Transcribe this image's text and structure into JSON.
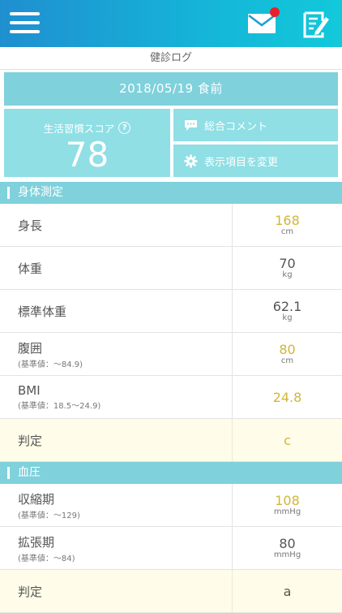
{
  "header": {
    "title": "健診ログ",
    "icons": [
      "menu-icon",
      "mail-icon",
      "edit-note-icon"
    ],
    "notification": true
  },
  "summary": {
    "date": "2018/05/19 食前",
    "score_label": "生活習慣スコア",
    "score_value": "78",
    "comment_label": "総合コメント",
    "change_items_label": "表示項目を変更"
  },
  "sections": {
    "body": {
      "title": "身体測定",
      "height": {
        "label": "身長",
        "value": "168",
        "unit": "cm"
      },
      "weight": {
        "label": "体重",
        "value": "70",
        "unit": "kg"
      },
      "std_weight": {
        "label": "標準体重",
        "value": "62.1",
        "unit": "kg"
      },
      "waist": {
        "label": "腹囲",
        "sub": "(基準値：〜84.9)",
        "value": "80",
        "unit": "cm"
      },
      "bmi": {
        "label": "BMI",
        "sub": "(基準値：18.5〜24.9)",
        "value": "24.8"
      },
      "judgement": {
        "label": "判定",
        "value": "c"
      }
    },
    "bp": {
      "title": "血圧",
      "systolic": {
        "label": "収縮期",
        "sub": "(基準値：〜129)",
        "value": "108",
        "unit": "mmHg"
      },
      "diastolic": {
        "label": "拡張期",
        "sub": "(基準値：〜84)",
        "value": "80",
        "unit": "mmHg"
      },
      "judgement": {
        "label": "判定",
        "value": "a"
      }
    }
  },
  "colors": {
    "accent": "#7fd1dc",
    "highlight": "#d2b53a",
    "judge_bg": "#fffde9"
  }
}
